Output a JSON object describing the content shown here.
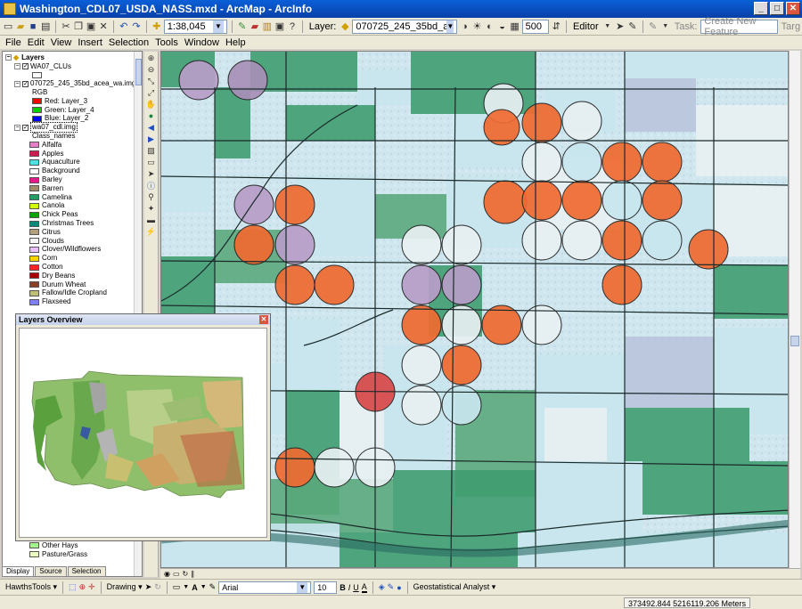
{
  "window": {
    "title": "Washington_CDL07_USDA_NASS.mxd - ArcMap - ArcInfo",
    "buttons": {
      "minimize": "_",
      "maximize": "□",
      "close": "✕"
    }
  },
  "standard_toolbar": {
    "scale": "1:38,045",
    "layer_label": "Layer:",
    "layer_value": "070725_245_35bd_acea_wa.ir",
    "num_value": "500",
    "editor_label": "Editor",
    "task_label": "Task:",
    "task_value": "Create New Feature",
    "target_label": "Targ"
  },
  "menu": [
    "File",
    "Edit",
    "View",
    "Insert",
    "Selection",
    "Tools",
    "Window",
    "Help"
  ],
  "toc": {
    "root": "Layers",
    "layer1": {
      "name": "WA07_CLUs"
    },
    "layer2": {
      "name": "070725_245_35bd_acea_wa.img",
      "mode": "RGB",
      "bands": [
        {
          "label": "Red:   Layer_3",
          "color": "#ff0000"
        },
        {
          "label": "Green: Layer_4",
          "color": "#00d000"
        },
        {
          "label": "Blue:  Layer_2",
          "color": "#0000ff"
        }
      ]
    },
    "layer3": {
      "name": "wa07_cdl.img",
      "field": "Class_names",
      "classes": [
        {
          "label": "Alfalfa",
          "color": "#e87ec8"
        },
        {
          "label": "Apples",
          "color": "#c81e50"
        },
        {
          "label": "Aquaculture",
          "color": "#46e6e6"
        },
        {
          "label": "Background",
          "color": "#ffffff"
        },
        {
          "label": "Barley",
          "color": "#e21a8a"
        },
        {
          "label": "Barren",
          "color": "#a08c68"
        },
        {
          "label": "Camelina",
          "color": "#1ea064"
        },
        {
          "label": "Canola",
          "color": "#d2ff00"
        },
        {
          "label": "Chick Peas",
          "color": "#00a800"
        },
        {
          "label": "Christmas Trees",
          "color": "#008c78"
        },
        {
          "label": "Citrus",
          "color": "#b4a07a"
        },
        {
          "label": "Clouds",
          "color": "#f4f4f4"
        },
        {
          "label": "Clover/Wildflowers",
          "color": "#e8bfff"
        },
        {
          "label": "Corn",
          "color": "#ffd300"
        },
        {
          "label": "Cotton",
          "color": "#ff2626"
        },
        {
          "label": "Dry Beans",
          "color": "#a80000"
        },
        {
          "label": "Durum Wheat",
          "color": "#8a4028"
        },
        {
          "label": "Fallow/Idle Cropland",
          "color": "#bfbf78"
        },
        {
          "label": "Flaxseed",
          "color": "#8080ff"
        }
      ],
      "tail": [
        {
          "label": "Other Crops",
          "color": "#00af4c"
        },
        {
          "label": "Other Hays",
          "color": "#a5f58d"
        },
        {
          "label": "Pasture/Grass",
          "color": "#e8ffbf"
        }
      ]
    },
    "tabs": [
      "Display",
      "Source",
      "Selection"
    ]
  },
  "overview": {
    "title": "Layers Overview"
  },
  "drawing_toolbar": {
    "hawths": "HawthsTools ▾",
    "drawing": "Drawing ▾",
    "font": "Arial",
    "font_size": "10",
    "bold": "B",
    "italic": "I",
    "underline": "U",
    "text_A": "A",
    "geostat": "Geostatistical Analyst ▾"
  },
  "status": {
    "coords": "373492.844  5216119.206 Meters"
  }
}
